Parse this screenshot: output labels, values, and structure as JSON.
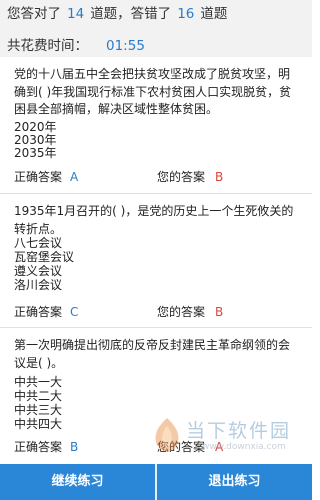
{
  "header": {
    "prefix": "您答对了",
    "correct_count": "14",
    "mid": "道题，答错了",
    "wrong_count": "16",
    "suffix": "道题",
    "time_label": "共花费时间：",
    "time_value": "01:55"
  },
  "answer_labels": {
    "correct": "正确答案",
    "mine": "您的答案"
  },
  "questions": [
    {
      "text": "党的十八届五中全会把扶贫攻坚改成了脱贫攻坚，明确到( )年我国现行标准下农村贫困人口实现脱贫，贫困县全部摘帽，解决区域性整体贫困。",
      "options": [
        "2020年",
        "2030年",
        "2035年"
      ],
      "correct": "A",
      "mine": "B"
    },
    {
      "text": "1935年1月召开的( )，是党的历史上一个生死攸关的转折点。",
      "options": [
        "八七会议",
        "瓦窑堡会议",
        "遵义会议",
        "洛川会议"
      ],
      "correct": "C",
      "mine": "B"
    },
    {
      "text": "第一次明确提出彻底的反帝反封建民主革命纲领的会议是( )。",
      "options": [
        "中共一大",
        "中共二大",
        "中共三大",
        "中共四大"
      ],
      "correct": "B",
      "mine": "A"
    }
  ],
  "watermark": {
    "text": "当下软件园",
    "url": "www.downxia.com"
  },
  "footer": {
    "continue": "继续练习",
    "exit": "退出练习"
  },
  "colors": {
    "accent": "#2a7cc7",
    "wrong": "#e0453a",
    "button": "#2a86d6"
  }
}
